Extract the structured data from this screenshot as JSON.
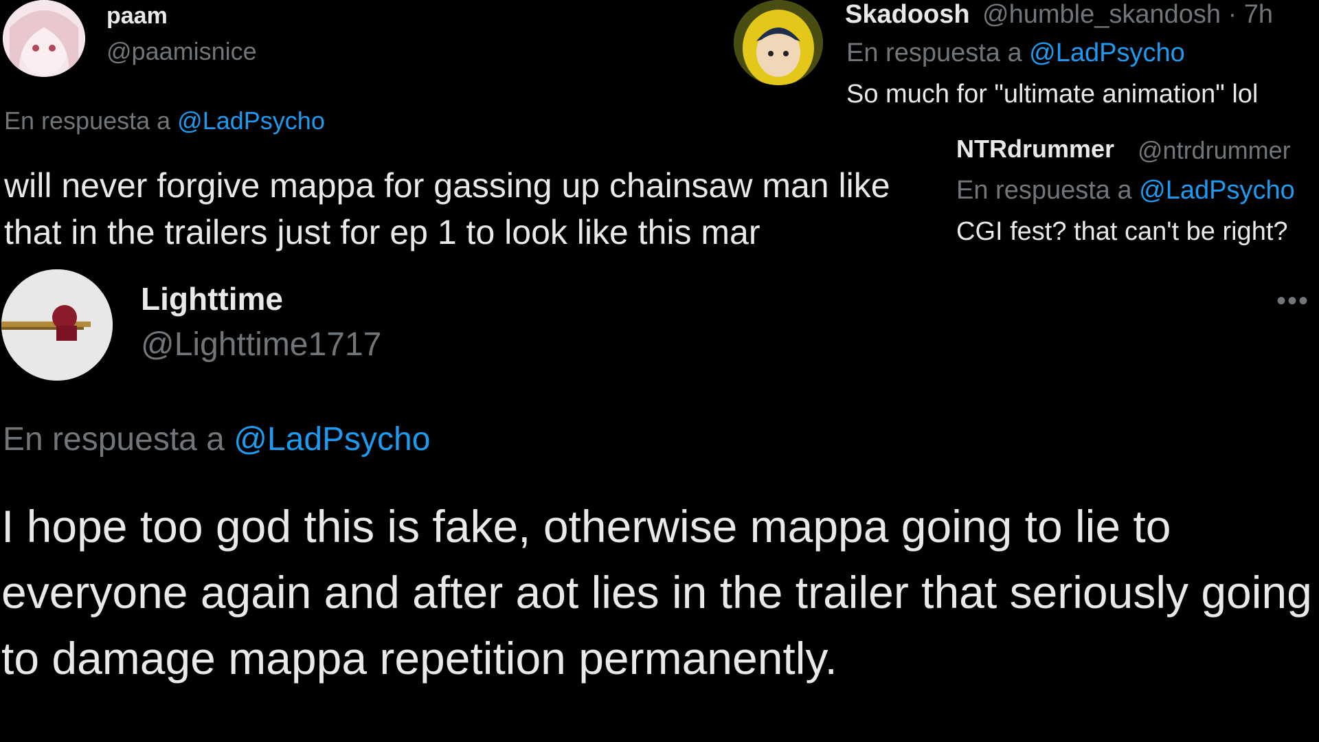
{
  "tweets": [
    {
      "name": "paam",
      "handle": "@paamisnice",
      "reply_prefix": "En respuesta a",
      "reply_to": "@LadPsycho",
      "text": "will never forgive mappa for gassing up chainsaw man like that in the trailers just for ep 1 to look like this mar"
    },
    {
      "name": "Skadoosh",
      "handle": "@humble_skandosh · 7h",
      "reply_prefix": "En respuesta a",
      "reply_to": "@LadPsycho",
      "text": "So much for \"ultimate animation\"  lol"
    },
    {
      "name": "NTRdrummer",
      "handle": "@ntrdrummer",
      "reply_prefix": "En respuesta a",
      "reply_to": "@LadPsycho",
      "text": "CGI fest? that can't be right?"
    },
    {
      "name": "Lighttime",
      "handle": "@Lighttime1717",
      "more": "•••",
      "reply_prefix": "En respuesta a",
      "reply_to": "@LadPsycho",
      "text": "I hope too god this is fake, otherwise mappa going to lie to everyone again and after aot lies in the trailer that seriously going to damage mappa repetition permanently."
    }
  ],
  "colors": {
    "background": "#000000",
    "text": "#e7e9ea",
    "secondary": "#71767b",
    "mention": "#1d9bf0"
  },
  "icons": {
    "more": "more-options-icon"
  }
}
